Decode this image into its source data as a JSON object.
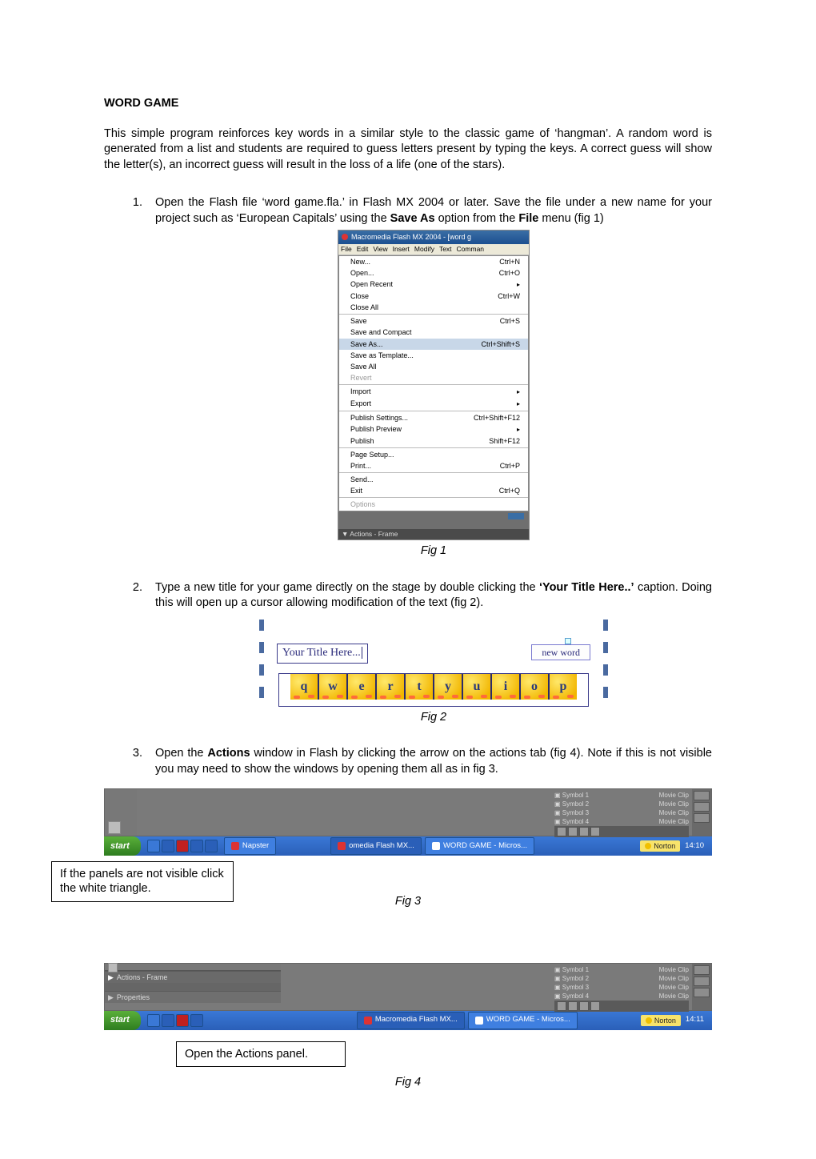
{
  "heading": "WORD GAME",
  "intro": "This simple program reinforces key words in a similar style to the classic game of ‘hangman’. A random word is generated from a list and students are required to guess letters present by typing the keys. A correct guess will show the letter(s), an incorrect guess will result in the loss of a life (one of the stars).",
  "step1_a": "Open the Flash file ‘word game.fla.’ in Flash MX 2004 or later. Save the file under a new name for your project such as ‘European Capitals’ using the ",
  "step1_b": "Save As",
  "step1_c": " option from the ",
  "step1_d": "File",
  "step1_e": " menu (fig 1)",
  "fig1_caption": "Fig 1",
  "flash": {
    "title": "Macromedia Flash MX 2004 - [word g",
    "menubar": [
      "File",
      "Edit",
      "View",
      "Insert",
      "Modify",
      "Text",
      "Comman"
    ],
    "items": [
      {
        "label": "New...",
        "sc": "Ctrl+N"
      },
      {
        "label": "Open...",
        "sc": "Ctrl+O"
      },
      {
        "label": "Open Recent",
        "sub": true
      },
      {
        "label": "Close",
        "sc": "Ctrl+W"
      },
      {
        "label": "Close All"
      },
      {
        "sep": true
      },
      {
        "label": "Save",
        "sc": "Ctrl+S"
      },
      {
        "label": "Save and Compact"
      },
      {
        "label": "Save As...",
        "sc": "Ctrl+Shift+S",
        "selected": true
      },
      {
        "label": "Save as Template..."
      },
      {
        "label": "Save All"
      },
      {
        "label": "Revert",
        "disabled": true
      },
      {
        "sep": true
      },
      {
        "label": "Import",
        "sub": true
      },
      {
        "label": "Export",
        "sub": true
      },
      {
        "sep": true
      },
      {
        "label": "Publish Settings...",
        "sc": "Ctrl+Shift+F12"
      },
      {
        "label": "Publish Preview",
        "sub": true
      },
      {
        "label": "Publish",
        "sc": "Shift+F12"
      },
      {
        "sep": true
      },
      {
        "label": "Page Setup..."
      },
      {
        "label": "Print...",
        "sc": "Ctrl+P"
      },
      {
        "sep": true
      },
      {
        "label": "Send..."
      },
      {
        "label": "Exit",
        "sc": "Ctrl+Q"
      },
      {
        "sep": true
      },
      {
        "label": "Options",
        "disabled": true
      }
    ],
    "actions_footer": "▼ Actions - Frame"
  },
  "step2_a": "Type a new title for your game directly on the stage by double clicking the ",
  "step2_b": "‘Your Title Here..’",
  "step2_c": " caption. Doing this will open up a cursor allowing modification of the text (fig 2).",
  "fig2_caption": "Fig 2",
  "game": {
    "title_text": "Your Title Here...",
    "new_word": "new word",
    "keys": [
      "q",
      "w",
      "e",
      "r",
      "t",
      "y",
      "u",
      "i",
      "o",
      "p"
    ]
  },
  "step3_a": "Open the ",
  "step3_b": "Actions",
  "step3_c": " window in Flash by clicking the arrow on the actions tab (fig 4). Note if this is not visible you may need to show the windows by opening them all as in fig 3.",
  "fig3_caption": "Fig 3",
  "fig4_caption": "Fig 4",
  "callout3": "If the panels are not visible click the white triangle.",
  "callout4": "Open the Actions panel.",
  "library": {
    "items": [
      {
        "name": "Symbol 1",
        "kind": "Movie Clip"
      },
      {
        "name": "Symbol 2",
        "kind": "Movie Clip"
      },
      {
        "name": "Symbol 3",
        "kind": "Movie Clip"
      },
      {
        "name": "Symbol 4",
        "kind": "Movie Clip"
      }
    ]
  },
  "taskbar": {
    "start": "start",
    "btn_napster": "Napster",
    "btn_flash": "Macromedia Flash MX...",
    "btn_flash_short": "omedia Flash MX...",
    "btn_word": "WORD GAME - Micros...",
    "norton": "Norton",
    "clock3": "14:10",
    "clock4": "14:11"
  },
  "panel4": {
    "actions": "Actions - Frame",
    "properties": "Properties"
  }
}
